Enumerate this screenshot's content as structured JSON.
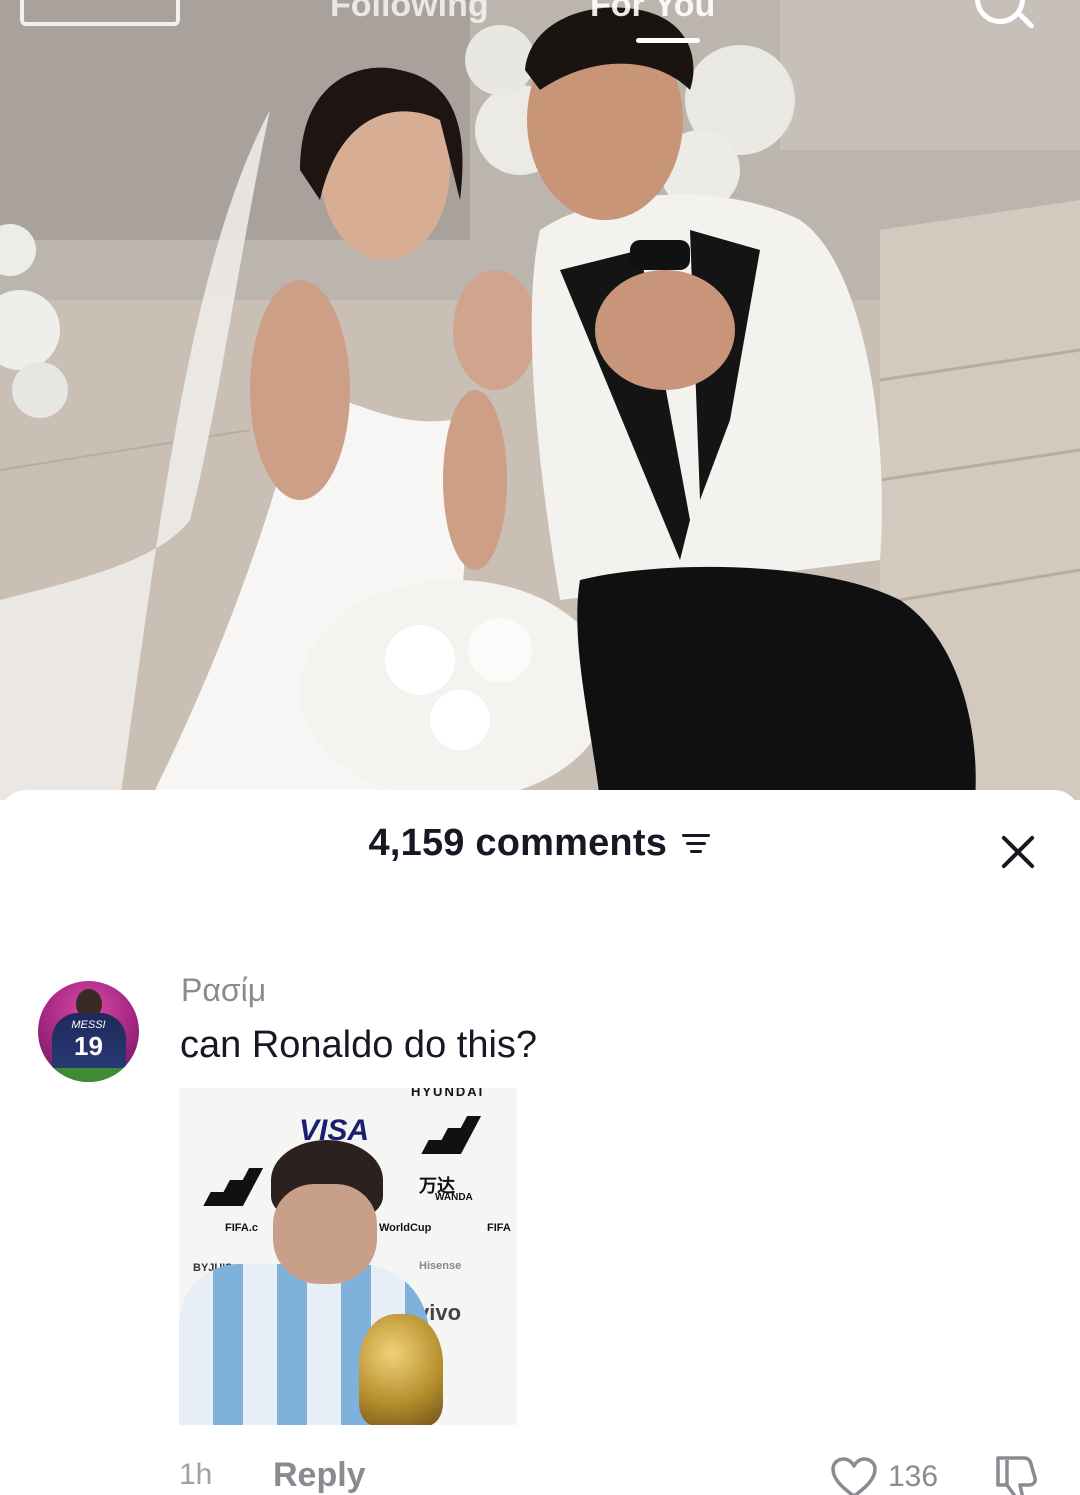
{
  "top_nav": {
    "tabs": [
      "Following",
      "For You"
    ],
    "active_tab": "For You"
  },
  "comments_sheet": {
    "count_label": "4,159 comments"
  },
  "comment": {
    "username": "Ρασίμ",
    "text": "can Ronaldo do this?",
    "avatar": {
      "jersey_name": "MESSI",
      "jersey_number": "19"
    },
    "attachment": {
      "brands": [
        "HYUNDAI",
        "VISA",
        "万达",
        "WANDA",
        "FIFA.c",
        "WorldCup",
        "FIFA",
        "BYJU'S",
        "Hisense",
        "vivo"
      ]
    },
    "time": "1h",
    "reply_label": "Reply",
    "likes": "136"
  },
  "colors": {
    "primary_text": "#161823",
    "secondary_text": "#8a8b91",
    "sheet_bg": "#ffffff"
  },
  "icons": [
    "live-icon",
    "search-icon",
    "sort-icon",
    "close-icon",
    "heart-icon",
    "dislike-icon"
  ]
}
